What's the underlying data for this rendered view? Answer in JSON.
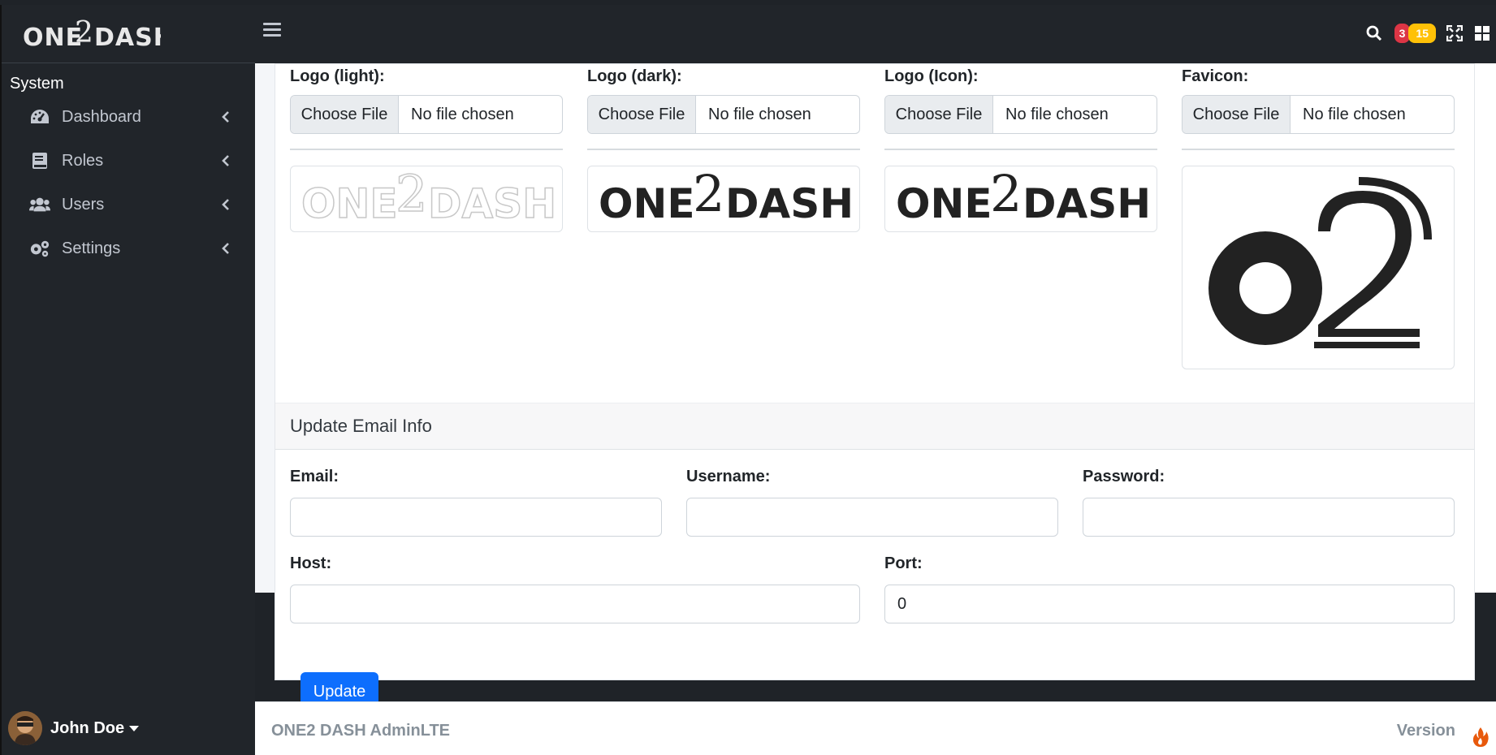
{
  "app": {
    "brand": "ONE2DASH"
  },
  "sidebar": {
    "section": "System",
    "items": [
      {
        "label": "Dashboard",
        "icon": "tachometer-icon"
      },
      {
        "label": "Roles",
        "icon": "book-icon"
      },
      {
        "label": "Users",
        "icon": "users-icon"
      },
      {
        "label": "Settings",
        "icon": "gears-icon"
      }
    ],
    "user": {
      "name": "John Doe"
    }
  },
  "topbar": {
    "badge_red": "3",
    "badge_yellow": "15",
    "colors": {
      "red": "#dc3545",
      "yellow": "#ffc107"
    }
  },
  "logos": [
    {
      "label": "Logo (light):",
      "button": "Choose File",
      "file": "No file chosen"
    },
    {
      "label": "Logo (dark):",
      "button": "Choose File",
      "file": "No file chosen"
    },
    {
      "label": "Logo (Icon):",
      "button": "Choose File",
      "file": "No file chosen"
    },
    {
      "label": "Favicon:",
      "button": "Choose File",
      "file": "No file chosen"
    }
  ],
  "email_section": {
    "title": "Update Email Info",
    "email_label": "Email:",
    "email_value": "",
    "username_label": "Username:",
    "username_value": "",
    "password_label": "Password:",
    "password_value": "",
    "host_label": "Host:",
    "host_value": "",
    "port_label": "Port:",
    "port_value": "0",
    "submit": "Update"
  },
  "footer": {
    "left": "ONE2 DASH AdminLTE",
    "right": "Version"
  }
}
